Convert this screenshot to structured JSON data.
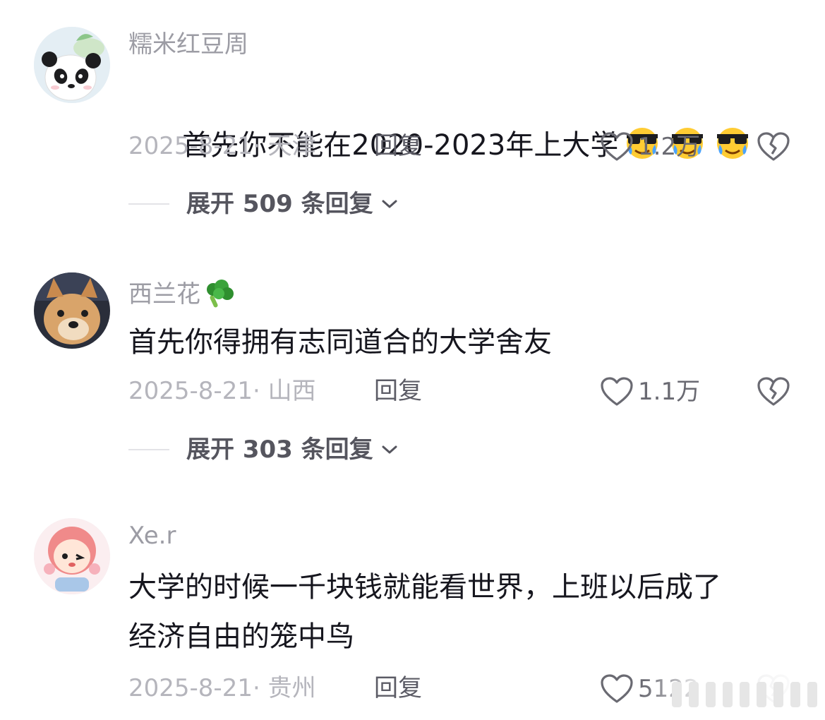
{
  "comments": [
    {
      "username": "糯米红豆周",
      "content": "首先你不能在2020-2023年上大学",
      "emoji_count": 3,
      "emoji_name": "sunglasses-crying-emoji",
      "date_location": "2025-8-21· 天津",
      "reply_label": "回复",
      "like_count": "1.2万",
      "expand_label": "展开 509 条回复"
    },
    {
      "username": "西兰花",
      "username_emoji": "broccoli-emoji",
      "content": "首先你得拥有志同道合的大学舍友",
      "date_location": "2025-8-21· 山西",
      "reply_label": "回复",
      "like_count": "1.1万",
      "expand_label": "展开 303 条回复"
    },
    {
      "username": "Xe.r",
      "content": "大学的时候一千块钱就能看世界，上班以后成了\n经济自由的笼中鸟",
      "date_location": "2025-8-21· 贵州",
      "reply_label": "回复",
      "like_count": "5122"
    }
  ],
  "icons": {
    "like": "heart-outline-icon",
    "dislike": "broken-heart-icon",
    "expand": "chevron-down-icon"
  },
  "colors": {
    "username": "#9c9ca4",
    "content": "#16161e",
    "meta": "#b5b5bc",
    "reply": "#5c5c66",
    "expand": "#55555e"
  }
}
